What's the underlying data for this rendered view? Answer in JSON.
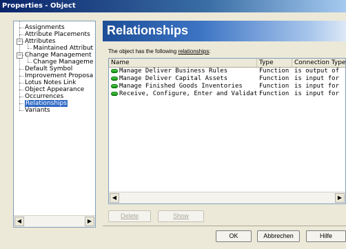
{
  "window": {
    "title": "Properties - Object"
  },
  "tree": {
    "items": [
      {
        "label": "Assignments",
        "level": 1
      },
      {
        "label": "Attribute Placements",
        "level": 1
      },
      {
        "label": "Attributes",
        "level": 1,
        "expander": "minus"
      },
      {
        "label": "Maintained Attribut",
        "level": 2
      },
      {
        "label": "Change Management",
        "level": 1,
        "expander": "minus"
      },
      {
        "label": "Change Manageme",
        "level": 2
      },
      {
        "label": "Default Symbol",
        "level": 1
      },
      {
        "label": "Improvement Proposa",
        "level": 1
      },
      {
        "label": "Lotus Notes Link",
        "level": 1
      },
      {
        "label": "Object Appearance",
        "level": 1
      },
      {
        "label": "Occurrences",
        "level": 1
      },
      {
        "label": "Relationships",
        "level": 1,
        "selected": true
      },
      {
        "label": "Variants",
        "level": 1
      }
    ]
  },
  "panel": {
    "title": "Relationships",
    "description_prefix": "The object has the following ",
    "description_link": "relationships",
    "description_suffix": ":"
  },
  "table": {
    "columns": [
      "Name",
      "Type",
      "Connection Type"
    ],
    "rows": [
      {
        "name": "Manage  Deliver Business  Rules",
        "type": "Function",
        "connection": "is output of"
      },
      {
        "name": "Manage  Deliver Capital  Assets",
        "type": "Function",
        "connection": "is input for"
      },
      {
        "name": "Manage  Finished Goods  Inventories",
        "type": "Function",
        "connection": "is input for"
      },
      {
        "name": "Receive, Configure, Enter and Validate ...",
        "type": "Function",
        "connection": "is input for"
      }
    ]
  },
  "buttons": {
    "delete": "Delete",
    "show": "Show",
    "ok": "OK",
    "cancel": "Abbrechen",
    "help": "Hilfe"
  },
  "icons": {
    "function": "function-icon",
    "scroll_left": "arrow-left-icon",
    "scroll_right": "arrow-right-icon"
  }
}
